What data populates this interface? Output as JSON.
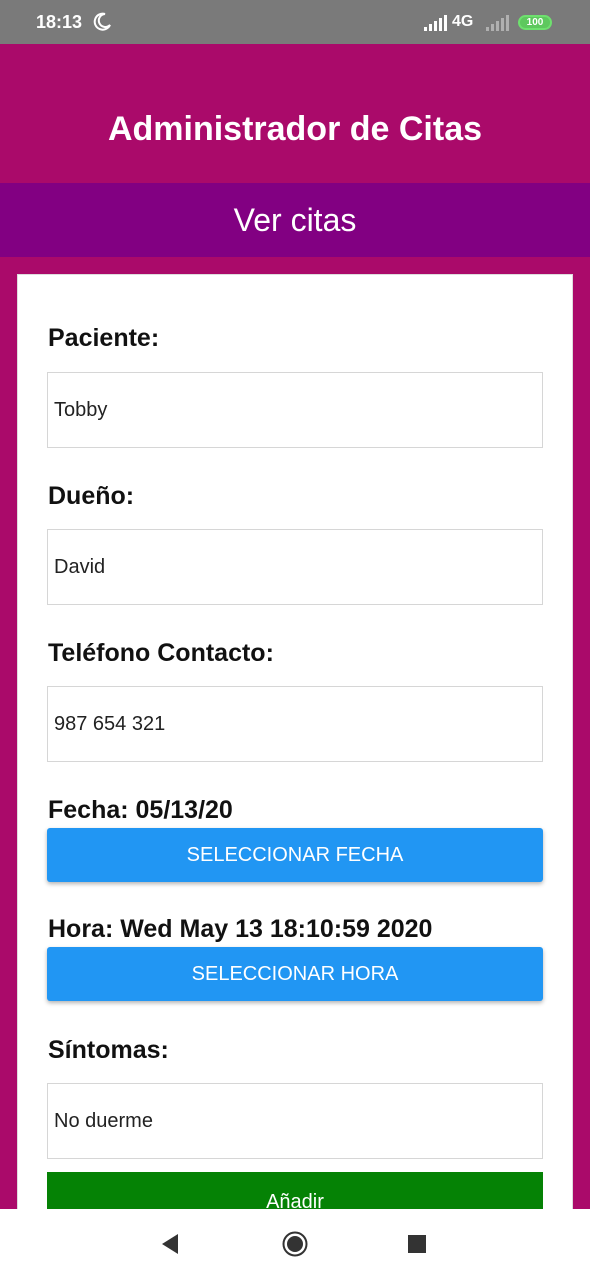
{
  "status": {
    "time": "18:13",
    "network": "4G",
    "battery": "100"
  },
  "header": {
    "title": "Administrador de Citas"
  },
  "nav": {
    "view_appointments": "Ver citas"
  },
  "form": {
    "patient_label": "Paciente:",
    "patient_value": "Tobby",
    "owner_label": "Dueño:",
    "owner_value": "David",
    "phone_label": "Teléfono Contacto:",
    "phone_value": "987 654 321",
    "date_label": "Fecha: 05/13/20",
    "date_button": "SELECCIONAR FECHA",
    "time_label": "Hora: Wed May 13 18:10:59 2020",
    "time_button": "SELECCIONAR HORA",
    "symptoms_label": "Síntomas:",
    "symptoms_value": "No duerme",
    "add_button": "Añadir"
  },
  "colors": {
    "header_bg": "#aa0a6a",
    "subbar_bg": "#820082",
    "button_blue": "#2196f3",
    "button_green": "#058205"
  },
  "icons": [
    "moon-icon",
    "signal-icon",
    "battery-icon",
    "back-icon",
    "home-icon",
    "recents-icon"
  ]
}
